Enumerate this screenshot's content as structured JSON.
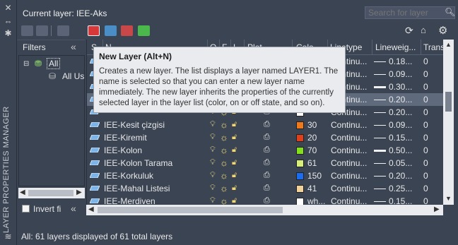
{
  "palette": {
    "title": "LAYER PROPERTIES MANAGER"
  },
  "header": {
    "current_layer": "Current layer: IEE-Aks",
    "search_placeholder": "Search for layer"
  },
  "filters": {
    "title": "Filters",
    "tree": [
      {
        "label": "All"
      },
      {
        "label": "All Us"
      }
    ],
    "invert_label": "Invert fi"
  },
  "columns": [
    "S...",
    "N...",
    "O...",
    "F...",
    "L...",
    "Plot...",
    "Colo...",
    "Linetype",
    "Lineweig...",
    "Trans"
  ],
  "layers": [
    {
      "name": "",
      "color": "",
      "color_hex": "#ffffff",
      "linetype": "Continu...",
      "lineweight": "0.18...",
      "transparency": "0"
    },
    {
      "name": "",
      "color": "",
      "color_hex": "#ffffff",
      "linetype": "Continu...",
      "lineweight": "0.09...",
      "transparency": "0"
    },
    {
      "name": "",
      "color": "",
      "color_hex": "#ffffff",
      "linetype": "Continu...",
      "lineweight": "0.30...",
      "transparency": "0"
    },
    {
      "name": "",
      "color": "",
      "color_hex": "#ffffff",
      "linetype": "Continu...",
      "lineweight": "0.20...",
      "transparency": "0"
    },
    {
      "name": "",
      "color": "",
      "color_hex": "#ffffff",
      "linetype": "Continu...",
      "lineweight": "0.20...",
      "transparency": "0"
    },
    {
      "name": "IEE-Kesit çizgisi",
      "color": "30",
      "color_hex": "#f07a1a",
      "linetype": "Continu...",
      "lineweight": "0.09...",
      "transparency": "0"
    },
    {
      "name": "IEE-Kiremit",
      "color": "20",
      "color_hex": "#e0401a",
      "linetype": "Continu...",
      "lineweight": "0.15...",
      "transparency": "0"
    },
    {
      "name": "IEE-Kolon",
      "color": "70",
      "color_hex": "#84e01a",
      "linetype": "Continu...",
      "lineweight": "0.50...",
      "transparency": "0"
    },
    {
      "name": "IEE-Kolon Tarama",
      "color": "61",
      "color_hex": "#d8f07a",
      "linetype": "Continu...",
      "lineweight": "0.05...",
      "transparency": "0"
    },
    {
      "name": "IEE-Korkuluk",
      "color": "150",
      "color_hex": "#1a6cf0",
      "linetype": "Continu...",
      "lineweight": "0.20...",
      "transparency": "0"
    },
    {
      "name": "IEE-Mahal Listesi",
      "color": "41",
      "color_hex": "#f0d29a",
      "linetype": "Continu...",
      "lineweight": "0.25...",
      "transparency": "0"
    },
    {
      "name": "IEE-Merdiven",
      "color": "wh...",
      "color_hex": "#ffffff",
      "linetype": "Continu...",
      "lineweight": "0.15...",
      "transparency": "0"
    }
  ],
  "tooltip": {
    "title": "New Layer (Alt+N)",
    "body": "Creates a new layer. The list displays a layer named LAYER1. The name is selected so that you can enter a new layer name immediately. The new layer inherits the properties of the currently selected layer in the layer list (color, on or off state, and so on)."
  },
  "status": "All: 61 layers displayed of 61 total layers"
}
